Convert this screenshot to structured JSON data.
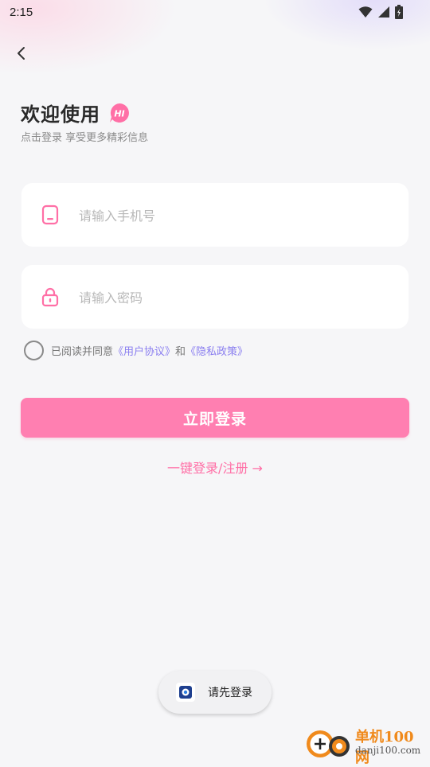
{
  "status_bar": {
    "time": "2:15",
    "icons": [
      "wifi-icon",
      "signal-icon",
      "battery-icon"
    ]
  },
  "header": {
    "back_icon": "chevron-left-icon",
    "title": "欢迎使用",
    "badge": "HI",
    "subtitle": "点击登录 享受更多精彩信息"
  },
  "form": {
    "phone": {
      "placeholder": "请输入手机号",
      "value": "",
      "icon": "phone-icon"
    },
    "password": {
      "placeholder": "请输入密码",
      "value": "",
      "icon": "lock-icon"
    }
  },
  "agreement": {
    "prefix": "已阅读并同意",
    "user_agreement": "《用户协议》",
    "and": "和",
    "privacy_policy": "《隐私政策》",
    "checked": false
  },
  "actions": {
    "login_label": "立即登录",
    "quick_login_label": "一键登录/注册 →"
  },
  "toast": {
    "text": "请先登录",
    "icon": "app-logo-icon"
  },
  "watermark": {
    "name": "单机100网",
    "url": "danji100.com"
  },
  "colors": {
    "accent": "#ff7fb1",
    "link": "#8a7ef0",
    "background": "#f6f6f8"
  }
}
